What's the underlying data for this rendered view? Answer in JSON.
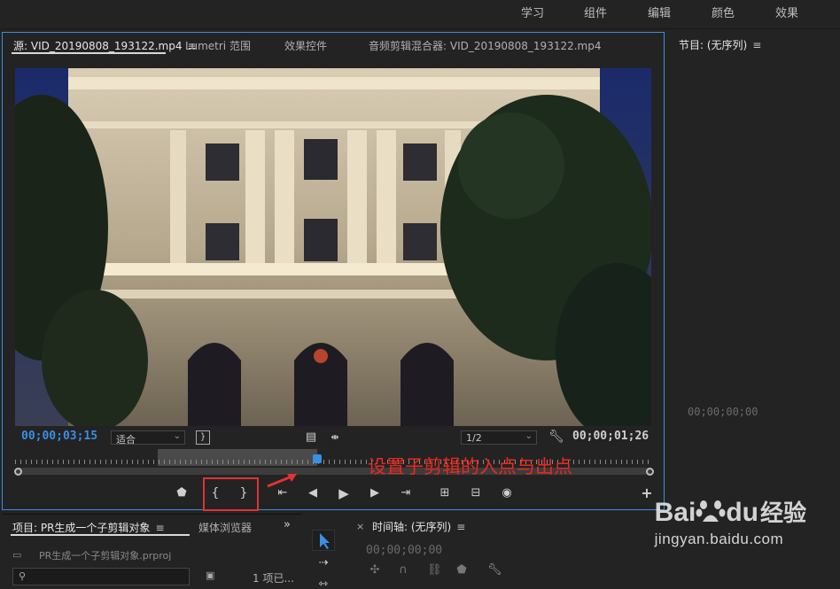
{
  "workspaces": [
    "学习",
    "组件",
    "编辑",
    "颜色",
    "效果"
  ],
  "source_panel": {
    "tabs": [
      {
        "label": "源: VID_20190808_193122.mp4"
      },
      {
        "label": "Lumetri 范围"
      },
      {
        "label": "效果控件"
      },
      {
        "label": "音频剪辑混合器: VID_20190808_193122.mp4"
      }
    ],
    "current_timecode": "00;00;03;15",
    "fit_label": "适合",
    "resolution_label": "1/2",
    "duration_timecode": "00;00;01;26",
    "annotation_text": "设置子剪辑的入点与出点",
    "controls": [
      "marker-icon",
      "mark-in-icon",
      "mark-out-icon",
      "go-to-in-icon",
      "step-back-icon",
      "play-icon",
      "step-forward-icon",
      "go-to-out-icon",
      "insert-icon",
      "overwrite-icon",
      "export-frame-icon",
      "add-button-icon"
    ]
  },
  "program_panel": {
    "title": "节目: (无序列)",
    "timecode": "00;00;00;00"
  },
  "project_panel": {
    "tab_label": "项目: PR生成一个子剪辑对象",
    "media_tab_label": "媒体浏览器",
    "file_label": "PR生成一个子剪辑对象.prproj",
    "items_label": "1 项已..."
  },
  "timeline_panel": {
    "title": "时间轴: (无序列)",
    "timecode": "00;00;00;00"
  },
  "watermark": {
    "brand": "Bai",
    "brand2": "du",
    "brand_cn": "经验",
    "url": "jingyan.baidu.com"
  },
  "colors": {
    "accent": "#3a8ee6",
    "annotation": "#e23232",
    "background": "#232323"
  }
}
